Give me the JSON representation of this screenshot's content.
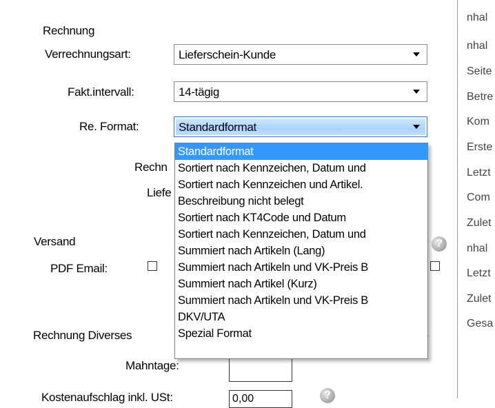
{
  "section_rechnung": "Rechnung",
  "verrechnungsart": {
    "label": "Verrechnungsart:",
    "value": "Lieferschein-Kunde"
  },
  "fakt_intervall": {
    "label": "Fakt.intervall:",
    "value": "14-tägig"
  },
  "re_format": {
    "label": "Re. Format:",
    "value": "Standardformat",
    "options": [
      "Standardformat",
      "Sortiert nach Kennzeichen, Datum und",
      "Sortiert nach Kennzeichen und Artikel.",
      "Beschreibung nicht belegt",
      "Sortiert nach KT4Code und Datum",
      "Sortiert nach Kennzeichen, Datum und",
      "Summiert nach Artikeln (Lang)",
      "Summiert nach Artikeln und VK-Preis B",
      "Summiert nach Artikel (Kurz)",
      "Summiert nach Artikeln und VK-Preis B",
      "DKV/UTA",
      "Spezial Format"
    ]
  },
  "hidden_label_1": "Rechn",
  "hidden_label_2": "Liefe",
  "section_versand": "Versand",
  "pdf_email": {
    "label": "PDF Email:"
  },
  "section_diverses": "Rechnung Diverses",
  "mahntage": {
    "label": "Mahntage:"
  },
  "bottom_partial": {
    "label": "Kostenaufschlag inkl. USt:",
    "value": "0,00"
  },
  "right_pane": [
    "nhal",
    "nhal",
    "Seite",
    "Betre",
    "Kom",
    "Erste",
    "Letzt",
    "Com",
    "Zulet",
    "nhal",
    "Letzt",
    "Zulet",
    "Gesa"
  ],
  "colors": {
    "selection": "#3399ff",
    "focus_border": "#3a6fd6",
    "divider": "#9a9a9a"
  }
}
